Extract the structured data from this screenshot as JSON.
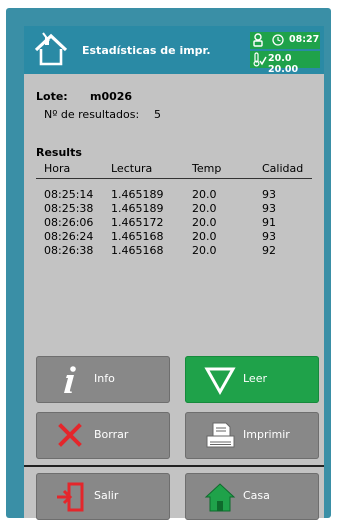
{
  "header": {
    "title": "Estadísticas de impr.",
    "time": "08:27",
    "temps": "20.0 20.00"
  },
  "lote": {
    "label": "Lote:",
    "value": "m0026"
  },
  "num_results": {
    "label": "Nº de resultados:",
    "value": "5"
  },
  "results": {
    "title": "Results",
    "columns": [
      "Hora",
      "Lectura",
      "Temp",
      "Calidad"
    ],
    "rows": [
      [
        "08:25:14",
        "1.465189",
        "20.0",
        "93"
      ],
      [
        "08:25:38",
        "1.465189",
        "20.0",
        "93"
      ],
      [
        "08:26:06",
        "1.465172",
        "20.0",
        "91"
      ],
      [
        "08:26:24",
        "1.465168",
        "20.0",
        "93"
      ],
      [
        "08:26:38",
        "1.465168",
        "20.0",
        "92"
      ]
    ]
  },
  "buttons": {
    "info": "Info",
    "leer": "Leer",
    "borrar": "Borrar",
    "imprimir": "Imprimir",
    "salir": "Salir",
    "casa": "Casa"
  },
  "colors": {
    "frame": "#3a8fa6",
    "header": "#2a8aa5",
    "accent_green": "#1fa24a",
    "button_gray": "#888888",
    "screen_bg": "#c3c3c3"
  }
}
